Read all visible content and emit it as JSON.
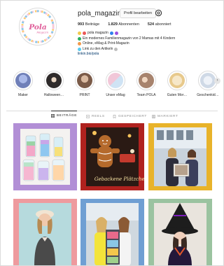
{
  "profile": {
    "username": "pola_magazin",
    "edit_button": "Profil bearbeiten",
    "avatar_text": "Pola",
    "stats": {
      "posts": "993",
      "posts_label": "Beiträge",
      "followers": "1.829",
      "followers_label": "Abonnenten",
      "following": "524",
      "following_label": "abonniert"
    },
    "bio": {
      "line1": "pola magazin",
      "line2": "Ein modernes Familienmagazin von 2 Mamas mit 4 Kindern",
      "line3": "Online, eMag & Print-Magazin",
      "line4": "Link zu den Artikeln",
      "link": "linkin.bio/pola"
    }
  },
  "highlights": [
    {
      "label": "Maker",
      "color": "#6f7fb8"
    },
    {
      "label": "Halloween…",
      "color": "#2e2a2a"
    },
    {
      "label": "PRINT",
      "color": "#7a5a48"
    },
    {
      "label": "Unser eMag",
      "color": "#f1c7d8"
    },
    {
      "label": "Team POLA",
      "color": "#a7836d"
    },
    {
      "label": "Guten Mor…",
      "color": "#f0e0c0"
    },
    {
      "label": "Geschenkid…",
      "color": "#cfd9e6"
    }
  ],
  "tabs": [
    {
      "label": "BEITRÄGE",
      "active": true,
      "icon": "grid-icon"
    },
    {
      "label": "REELS",
      "active": false,
      "icon": "reels-icon"
    },
    {
      "label": "GESPEICHERT",
      "active": false,
      "icon": "bookmark-icon"
    },
    {
      "label": "MARKIERT",
      "active": false,
      "icon": "tag-icon"
    }
  ],
  "posts": [
    {
      "subject": "colorful salt jars",
      "frame": "#b28fd6"
    },
    {
      "subject": "gingerbread christmas cookies",
      "frame": "#b0221f",
      "caption": "Gebackene Plätzchen"
    },
    {
      "subject": "women with pictures in city",
      "frame": "#e8b32a"
    },
    {
      "subject": "woman with beret",
      "frame": "#ee9a9e"
    },
    {
      "subject": "two women with magazine tower",
      "frame": "#6f9fd3"
    },
    {
      "subject": "halloween witch costume",
      "frame": "#9bc3a0"
    }
  ],
  "colors": {
    "accent": "#0095f6",
    "text": "#262626",
    "muted": "#8e8e8e",
    "border": "#dbdbdb"
  }
}
